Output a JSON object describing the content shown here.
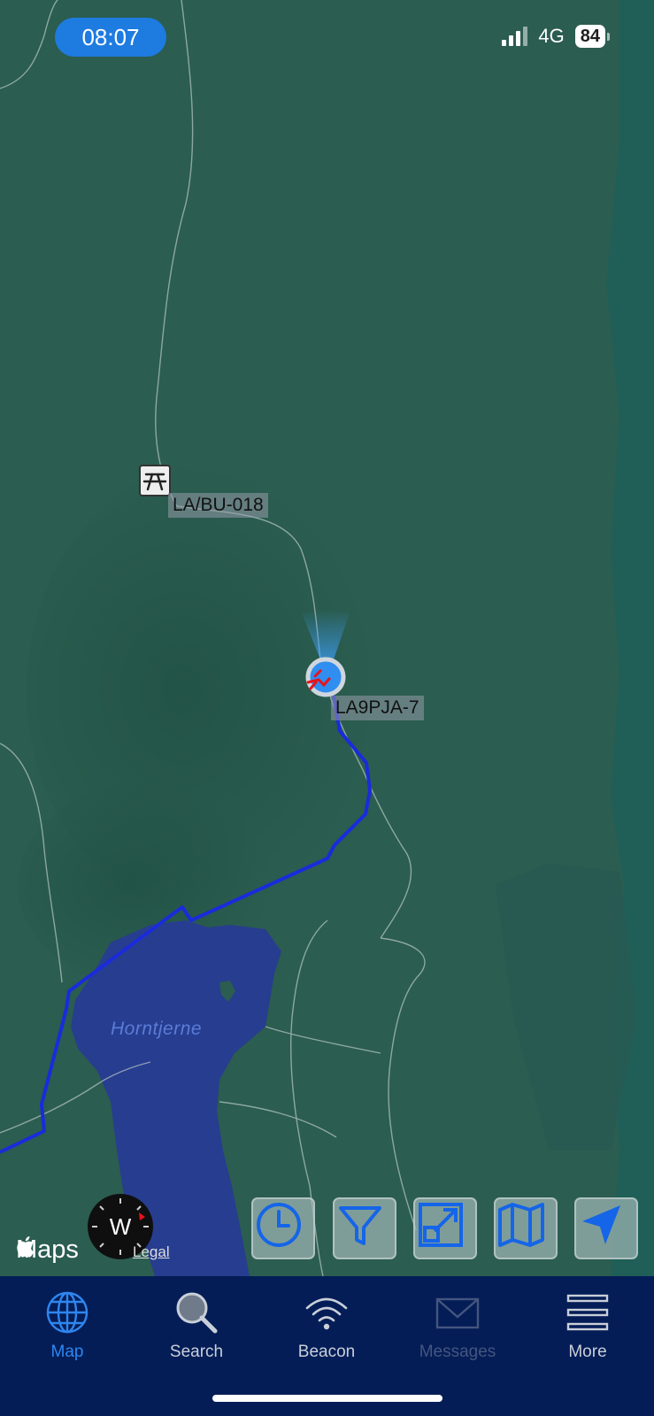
{
  "status_bar": {
    "time": "08:07",
    "network": "4G",
    "battery": "84"
  },
  "map": {
    "labels": {
      "waypoint": "LA/BU-018",
      "station": "LA9PJA-7",
      "lake": "Horntjerne"
    },
    "compass_letter": "W",
    "attribution": "Maps",
    "legal": "Legal",
    "colors": {
      "terrain": "#2b5d50",
      "water": "#273d8f",
      "track": "#1a2bdc",
      "position": "#2f8ef0"
    }
  },
  "map_buttons": [
    {
      "icon": "clock-icon"
    },
    {
      "icon": "filter-icon"
    },
    {
      "icon": "expand-icon"
    },
    {
      "icon": "map-icon"
    },
    {
      "icon": "location-arrow-icon"
    }
  ],
  "tabbar": {
    "tabs": [
      {
        "label": "Map",
        "icon": "globe-icon",
        "state": "active"
      },
      {
        "label": "Search",
        "icon": "magnifier-icon",
        "state": "normal"
      },
      {
        "label": "Beacon",
        "icon": "wifi-beacon-icon",
        "state": "normal"
      },
      {
        "label": "Messages",
        "icon": "envelope-icon",
        "state": "disabled"
      },
      {
        "label": "More",
        "icon": "menu-icon",
        "state": "normal"
      }
    ],
    "colors": {
      "active": "#2e86ef",
      "normal": "#c9cfd8",
      "disabled": "#44557f"
    }
  }
}
